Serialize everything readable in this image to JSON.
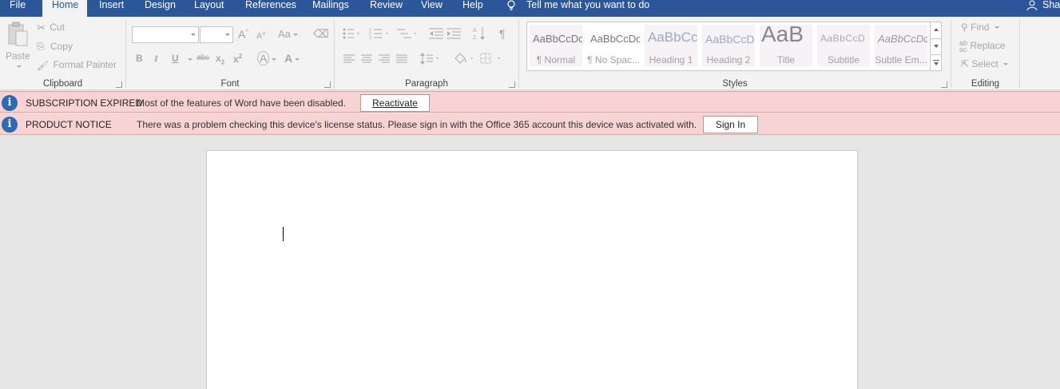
{
  "tabs": {
    "file": "File",
    "home": "Home",
    "insert": "Insert",
    "design": "Design",
    "layout": "Layout",
    "references": "References",
    "mailings": "Mailings",
    "review": "Review",
    "view": "View",
    "help": "Help"
  },
  "tell_me": "Tell me what you want to do",
  "share": "Share",
  "clipboard": {
    "paste": "Paste",
    "cut": "Cut",
    "copy": "Copy",
    "format_painter": "Format Painter",
    "label": "Clipboard"
  },
  "font": {
    "label": "Font",
    "grow": "A",
    "shrink": "A",
    "change_case": "Aa",
    "bold": "B",
    "italic": "I",
    "underline": "U",
    "strike": "abc",
    "subscript": "x",
    "superscript": "x",
    "text_effects": "A",
    "font_color": "A"
  },
  "paragraph": {
    "label": "Paragraph"
  },
  "styles": {
    "label": "Styles",
    "items": [
      {
        "preview": "AaBbCcDc",
        "name": "¶ Normal"
      },
      {
        "preview": "AaBbCcDc",
        "name": "¶ No Spac..."
      },
      {
        "preview": "AaBbCc",
        "name": "Heading 1"
      },
      {
        "preview": "AaBbCcD",
        "name": "Heading 2"
      },
      {
        "preview": "AaB",
        "name": "Title"
      },
      {
        "preview": "AaBbCcD",
        "name": "Subtitle"
      },
      {
        "preview": "AaBbCcDc",
        "name": "Subtle Em..."
      }
    ]
  },
  "editing": {
    "label": "Editing",
    "find": "Find",
    "replace": "Replace",
    "select": "Select"
  },
  "notices": [
    {
      "title": "SUBSCRIPTION EXPIRED",
      "message": "Most of the features of Word have been disabled.",
      "button": "Reactivate"
    },
    {
      "title": "PRODUCT NOTICE",
      "message": "There was a problem checking this device's license status. Please sign in with the Office 365 account this device was activated with.",
      "button": "Sign In"
    }
  ],
  "colors": {
    "brand": "#2b579a",
    "notice_bg": "#f7d3d3",
    "info_icon": "#2b6bb5"
  }
}
